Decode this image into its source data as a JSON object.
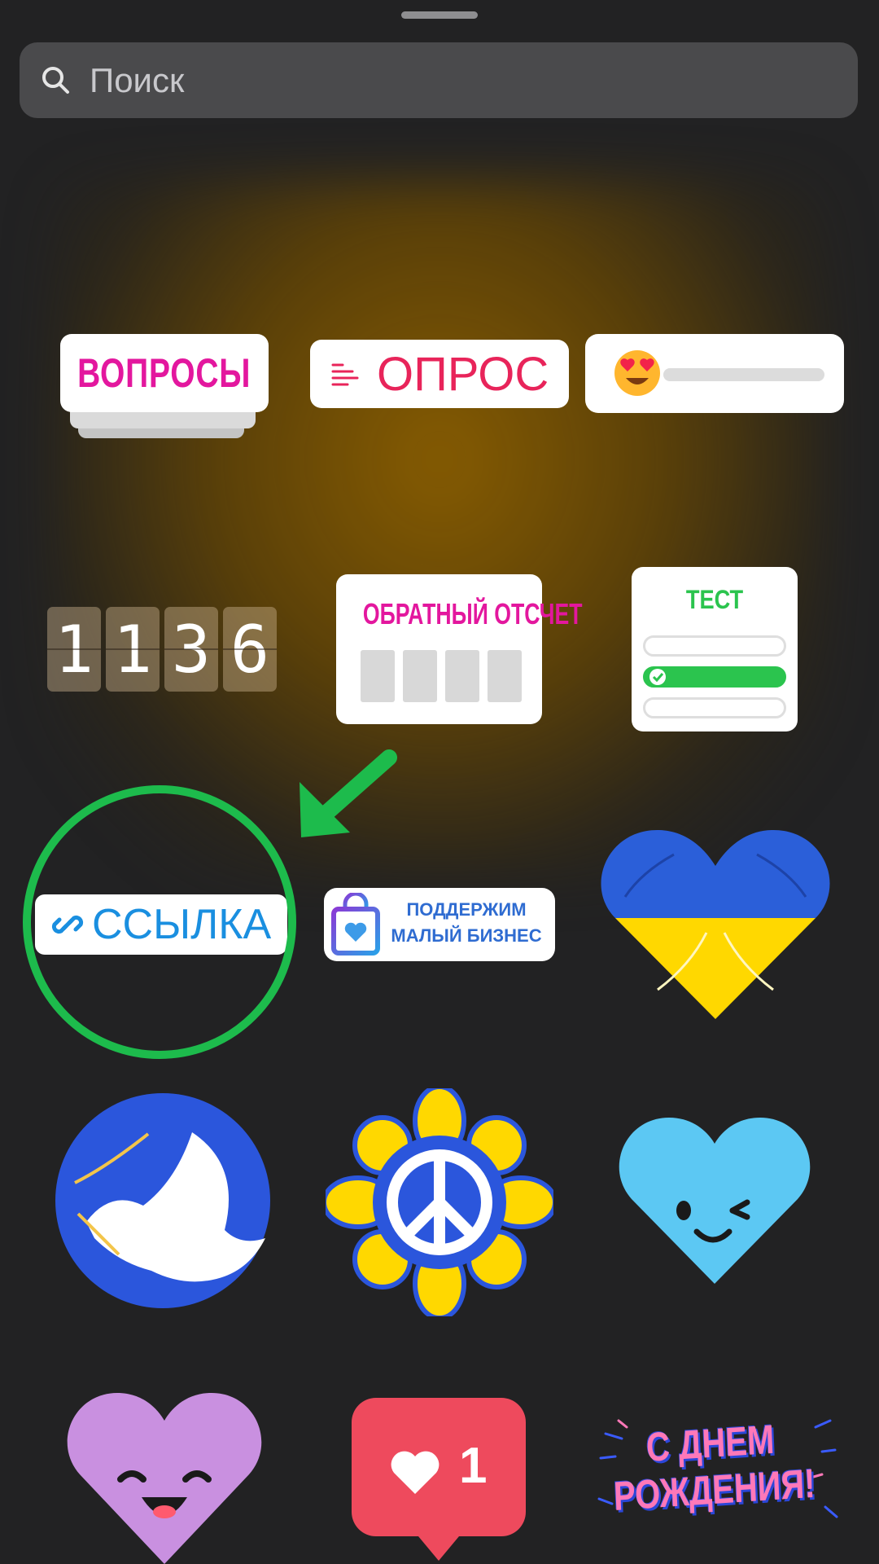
{
  "search": {
    "placeholder": "Поиск"
  },
  "stickers": {
    "questions": "ВОПРОСЫ",
    "poll": "ОПРОС",
    "slider_emoji": "heart-eyes-emoji",
    "countdown_digits": [
      "1",
      "1",
      "3",
      "6"
    ],
    "countdown": "ОБРАТНЫЙ ОТСЧЕТ",
    "quiz": "ТЕСТ",
    "link": "ССЫЛКА",
    "small_business_line1": "ПОДДЕРЖИМ",
    "small_business_line2": "МАЛЫЙ БИЗНЕС",
    "likes_count": "1",
    "birthday_line1": "С ДНЕМ",
    "birthday_line2": "РОЖДЕНИЯ!"
  },
  "colors": {
    "background": "#222223",
    "highlight_circle": "#1dbb4c",
    "ukraine_blue": "#2b5fd9",
    "ukraine_yellow": "#ffd800",
    "likes_red": "#ee4a5d"
  }
}
